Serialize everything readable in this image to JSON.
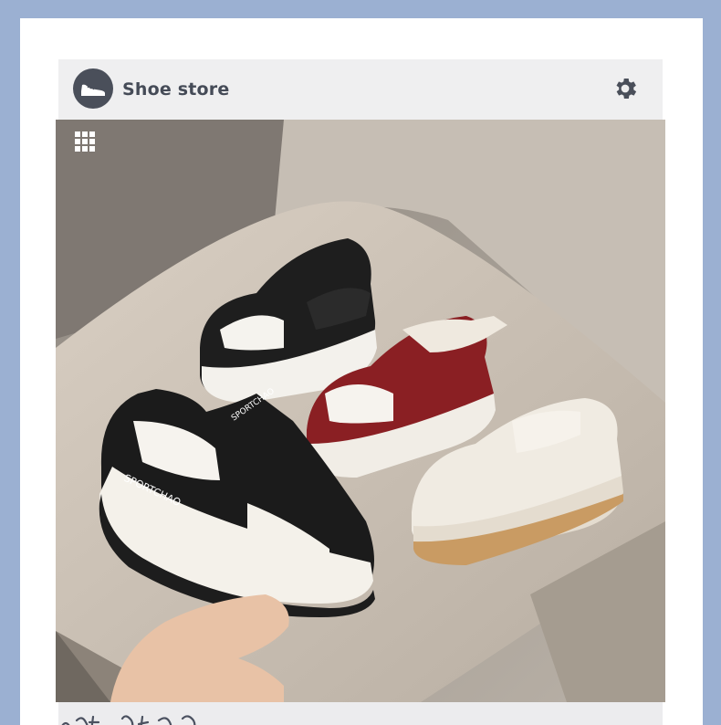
{
  "app": {
    "title": "Shoe store"
  },
  "icons": {
    "logo": "sneaker-icon",
    "settings": "gear-icon",
    "gallery": "grid-icon"
  },
  "product_image": {
    "shoes": [
      {
        "color": "black",
        "brand_text": "SPORTCHAO",
        "strap_text": "SPORTCHAO"
      },
      {
        "color": "black",
        "strap_text": "SPORTCHAO"
      },
      {
        "color": "burgundy"
      },
      {
        "color": "white"
      }
    ]
  },
  "colors": {
    "frame": "#9bb0d2",
    "header_bg": "#efeff0",
    "title_text": "#454b57",
    "logo_bg": "#4a4f5a"
  }
}
